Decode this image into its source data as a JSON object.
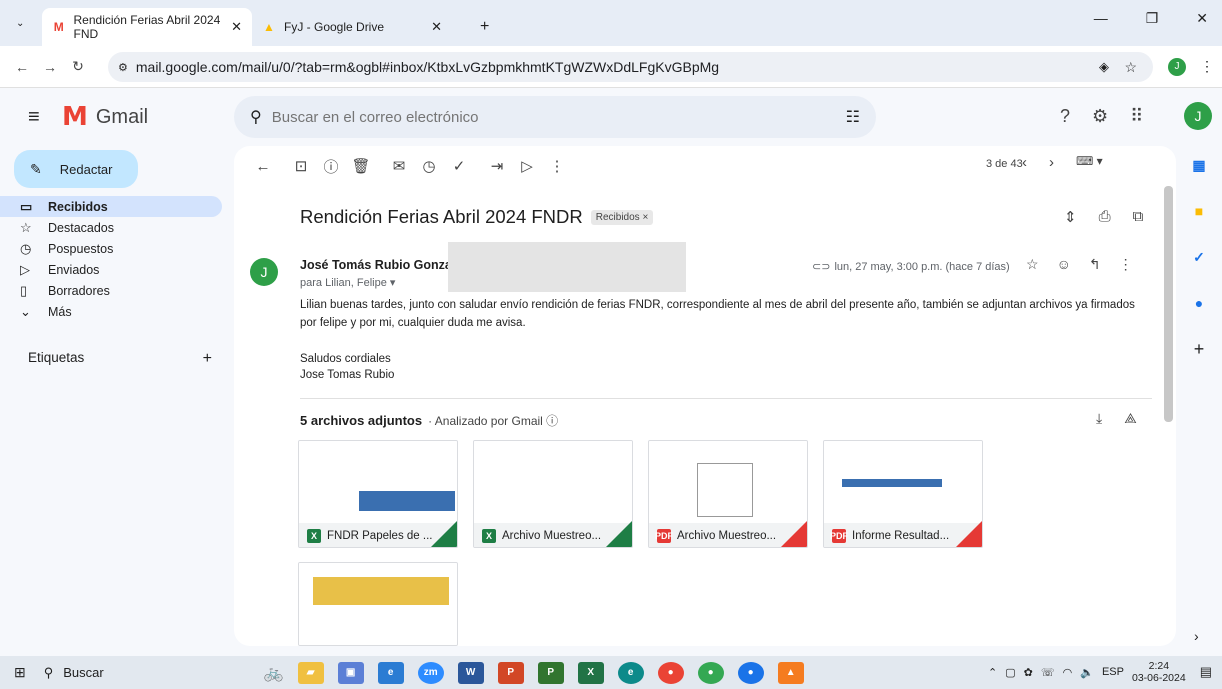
{
  "browser": {
    "tabs": [
      {
        "title": "Rendición Ferias Abril 2024 FND",
        "favicon": "gmail-icon",
        "active": true
      },
      {
        "title": "FyJ - Google Drive",
        "favicon": "drive-icon",
        "active": false
      }
    ],
    "new_tab": "+",
    "url": "mail.google.com/mail/u/0/?tab=rm&ogbl#inbox/KtbxLvGzbpmkhmtKTgWZWxDdLFgKvGBpMg",
    "profile_initial": "J"
  },
  "gmail": {
    "logo_text": "Gmail",
    "search_placeholder": "Buscar en el correo electrónico",
    "avatar_initial": "J",
    "compose_label": "Redactar",
    "nav": [
      {
        "label": "Recibidos",
        "icon": "inbox-icon",
        "selected": true
      },
      {
        "label": "Destacados",
        "icon": "star-icon",
        "selected": false
      },
      {
        "label": "Pospuestos",
        "icon": "clock-icon",
        "selected": false
      },
      {
        "label": "Enviados",
        "icon": "send-icon",
        "selected": false
      },
      {
        "label": "Borradores",
        "icon": "draft-icon",
        "selected": false
      },
      {
        "label": "Más",
        "icon": "chevron-down-icon",
        "selected": false
      }
    ],
    "labels_title": "Etiquetas",
    "labels_add": "+"
  },
  "message": {
    "counter": "3 de 43",
    "subject": "Rendición Ferias Abril 2024 FNDR",
    "chip": "Recibidos",
    "chip_close": "×",
    "sender_initial": "J",
    "sender_name": "José Tomás Rubio Gonza",
    "to": "para Lilian, Felipe",
    "date": "lun, 27 may, 3:00 p.m. (hace 7 días)",
    "body": "Lilian buenas tardes, junto con saludar envío rendición de ferias FNDR, correspondiente al mes de abril del presente año, también se adjuntan archivos ya firmados por felipe y por mi, cualquier duda me avisa.",
    "signature": [
      "Saludos cordiales",
      "Jose Tomas Rubio"
    ],
    "attachments_title": "5 archivos adjuntos",
    "attachments_sub": "Analizado por Gmail",
    "attachments": [
      {
        "name": "FNDR Papeles de ...",
        "type": "xlsx"
      },
      {
        "name": "Archivo Muestreo...",
        "type": "xlsx"
      },
      {
        "name": "Archivo Muestreo...",
        "type": "pdf"
      },
      {
        "name": "Informe Resultad...",
        "type": "pdf"
      },
      {
        "name": "",
        "type": "image"
      }
    ]
  },
  "taskbar": {
    "search_label": "Buscar",
    "lang": "ESP",
    "time": "2:24",
    "date": "03-06-2024"
  },
  "colors": {
    "accent": "#0b57d0",
    "selected_nav": "#d3e3fd",
    "compose": "#c2e7ff",
    "avatar": "#2e9f48"
  }
}
